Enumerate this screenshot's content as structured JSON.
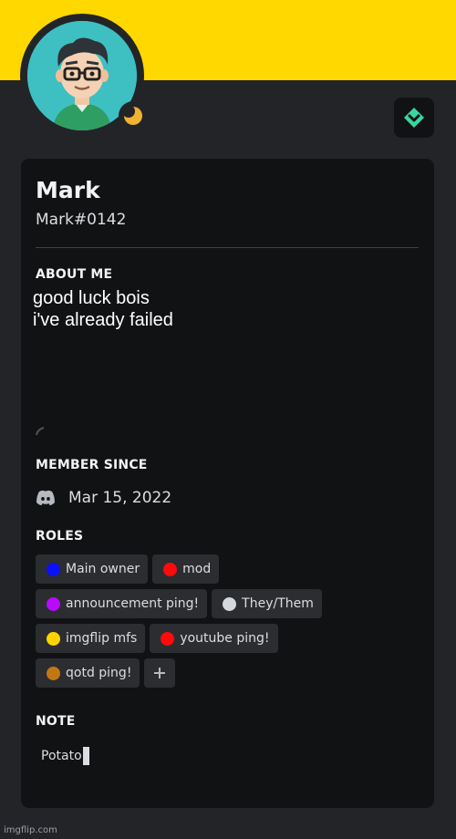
{
  "profile": {
    "display_name": "Mark",
    "username": "Mark#0142"
  },
  "about": {
    "title": "ABOUT ME",
    "lines": [
      "good luck bois",
      "i've already failed"
    ]
  },
  "member_since": {
    "title": "MEMBER SINCE",
    "date": "Mar 15, 2022",
    "icon": "discord-logo-icon"
  },
  "roles": {
    "title": "ROLES",
    "items": [
      {
        "label": "Main owner",
        "color": "#0a10ff"
      },
      {
        "label": "mod",
        "color": "#ff0a0a"
      },
      {
        "label": "announcement ping!",
        "color": "#b80aff"
      },
      {
        "label": "They/Them",
        "color": "#d4d7dc"
      },
      {
        "label": "imgflip mfs",
        "color": "#ffd400"
      },
      {
        "label": "youtube ping!",
        "color": "#ff0a0a"
      },
      {
        "label": "qotd ping!",
        "color": "#c27812"
      }
    ],
    "add_icon": "plus-icon"
  },
  "note": {
    "title": "NOTE",
    "value": "Potato"
  },
  "watermark": "imgflip.com",
  "colors": {
    "banner": "#ffd800",
    "avatar_bg": "#3ebfc2",
    "status_idle": "#f0b232",
    "badge_accent": "#3bd6a0"
  }
}
